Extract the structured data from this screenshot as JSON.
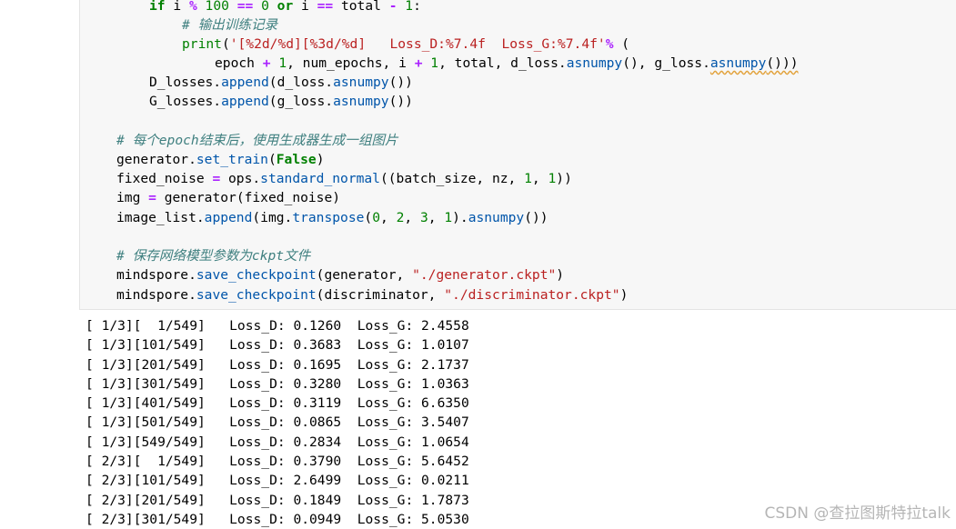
{
  "code": {
    "l1": [
      "if",
      " i ",
      "%",
      " ",
      "100",
      " ",
      "==",
      " ",
      "0",
      " ",
      "or",
      " i ",
      "==",
      " total ",
      "-",
      " ",
      "1",
      ":"
    ],
    "comment_train_log": "# 输出训练记录",
    "print_call": {
      "fn": "print",
      "open": "(",
      "fmt": "'[%2d/%d][%3d/%d]   Loss_D:%7.4f  Loss_G:%7.4f'",
      "mod": " % (",
      "pct": "%"
    },
    "print_args": {
      "epoch": "epoch ",
      "plus1": "+",
      "one1": "1",
      "rest1": ", num_epochs, i ",
      "plus2": "+",
      "one2": "1",
      "rest2": ", total, d_loss.",
      "asnumpy1": "asnumpy",
      "rest3": "(), g_loss.",
      "asnumpy2": "asnumpy",
      "rest4": "()))"
    },
    "d_losses": {
      "a": "D_losses.",
      "append": "append",
      "b": "(d_loss.",
      "asnumpy": "asnumpy",
      "c": "())"
    },
    "g_losses": {
      "a": "G_losses.",
      "append": "append",
      "b": "(g_loss.",
      "asnumpy": "asnumpy",
      "c": "())"
    },
    "comment_epoch": "# 每个epoch结束后，使用生成器生成一组图片",
    "set_train": {
      "a": "generator.",
      "fn": "set_train",
      "b": "(",
      "kw": "False",
      "c": ")"
    },
    "fixed_noise": {
      "a": "fixed_noise ",
      "eq": "=",
      "b": " ops.",
      "fn": "standard_normal",
      "c": "((batch_size, nz, ",
      "n1": "1",
      "d": ", ",
      "n2": "1",
      "e": "))"
    },
    "img": {
      "a": "img ",
      "eq": "=",
      "b": " generator(fixed_noise)"
    },
    "image_list": {
      "a": "image_list.",
      "fn": "append",
      "b": "(img.",
      "fn2": "transpose",
      "c": "(",
      "n0": "0",
      "d": ", ",
      "n2": "2",
      "e": ", ",
      "n3": "3",
      "f": ", ",
      "n1": "1",
      "g": ").",
      "fn3": "asnumpy",
      "h": "())"
    },
    "comment_ckpt": "# 保存网络模型参数为ckpt文件",
    "save_gen": {
      "a": "mindspore.",
      "fn": "save_checkpoint",
      "b": "(generator, ",
      "s": "\"./generator.ckpt\"",
      "c": ")"
    },
    "save_disc": {
      "a": "mindspore.",
      "fn": "save_checkpoint",
      "b": "(discriminator, ",
      "s": "\"./discriminator.ckpt\"",
      "c": ")"
    }
  },
  "output_lines": [
    "[ 1/3][  1/549]   Loss_D: 0.1260  Loss_G: 2.4558",
    "[ 1/3][101/549]   Loss_D: 0.3683  Loss_G: 1.0107",
    "[ 1/3][201/549]   Loss_D: 0.1695  Loss_G: 2.1737",
    "[ 1/3][301/549]   Loss_D: 0.3280  Loss_G: 1.0363",
    "[ 1/3][401/549]   Loss_D: 0.3119  Loss_G: 6.6350",
    "[ 1/3][501/549]   Loss_D: 0.0865  Loss_G: 3.5407",
    "[ 1/3][549/549]   Loss_D: 0.2834  Loss_G: 1.0654",
    "[ 2/3][  1/549]   Loss_D: 0.3790  Loss_G: 5.6452",
    "[ 2/3][101/549]   Loss_D: 2.6499  Loss_G: 0.0211",
    "[ 2/3][201/549]   Loss_D: 0.1849  Loss_G: 1.7873",
    "[ 2/3][301/549]   Loss_D: 0.0949  Loss_G: 5.0530"
  ],
  "watermark": "CSDN @查拉图斯特拉talk"
}
